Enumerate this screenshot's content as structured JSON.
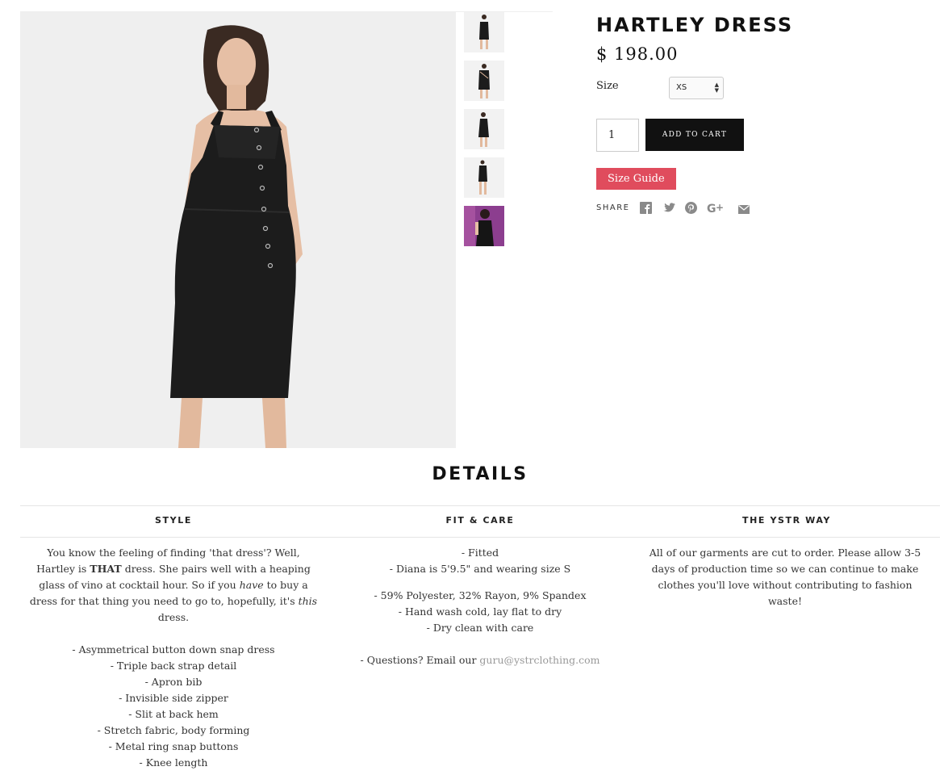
{
  "product": {
    "title": "HARTLEY DRESS",
    "price": "$ 198.00",
    "size_label": "Size",
    "size_value": "XS",
    "quantity": "1",
    "add_to_cart": "ADD TO CART",
    "size_guide": "Size Guide",
    "share_label": "SHARE",
    "share_icons": [
      "facebook-icon",
      "twitter-icon",
      "pinterest-icon",
      "google-plus-icon",
      "email-icon"
    ]
  },
  "colors": {
    "accent_red": "#e04c5d",
    "button_black": "#111111",
    "thumb_purple": "#8c3e8f",
    "link_gray": "#999999"
  },
  "details": {
    "heading": "DETAILS",
    "tabs": [
      "STYLE",
      "FIT & CARE",
      "THE YSTR WAY"
    ],
    "style": {
      "intro_1": "You know the feeling of finding 'that dress'? Well, Hartley is ",
      "intro_bold": "THAT",
      "intro_2": " dress. She pairs well with a heaping glass of vino at cocktail hour. So if you ",
      "intro_em1": "have",
      "intro_3": " to buy a dress for that thing you need to go to, hopefully, it's ",
      "intro_em2": "this",
      "intro_4": " dress.",
      "features": [
        "- Asymmetrical button down snap dress",
        "- Triple back strap detail",
        "- Apron bib",
        "- Invisible side zipper",
        "- Slit at back hem",
        "- Stretch fabric, body forming",
        "- Metal ring snap buttons",
        "- Knee length"
      ]
    },
    "fit": {
      "lines_1": [
        "- Fitted",
        "- Diana is 5'9.5\" and wearing size S"
      ],
      "lines_2": [
        "- 59% Polyester, 32% Rayon, 9% Spandex",
        "- Hand wash cold, lay flat to dry",
        "- Dry clean with care"
      ],
      "questions": "- Questions? Email our ",
      "email": "guru@ystrclothing.com"
    },
    "ystr_way": "All of our garments are cut to order. Please allow 3-5 days of production time so we can continue to make clothes you'll love without contributing to fashion waste!"
  }
}
